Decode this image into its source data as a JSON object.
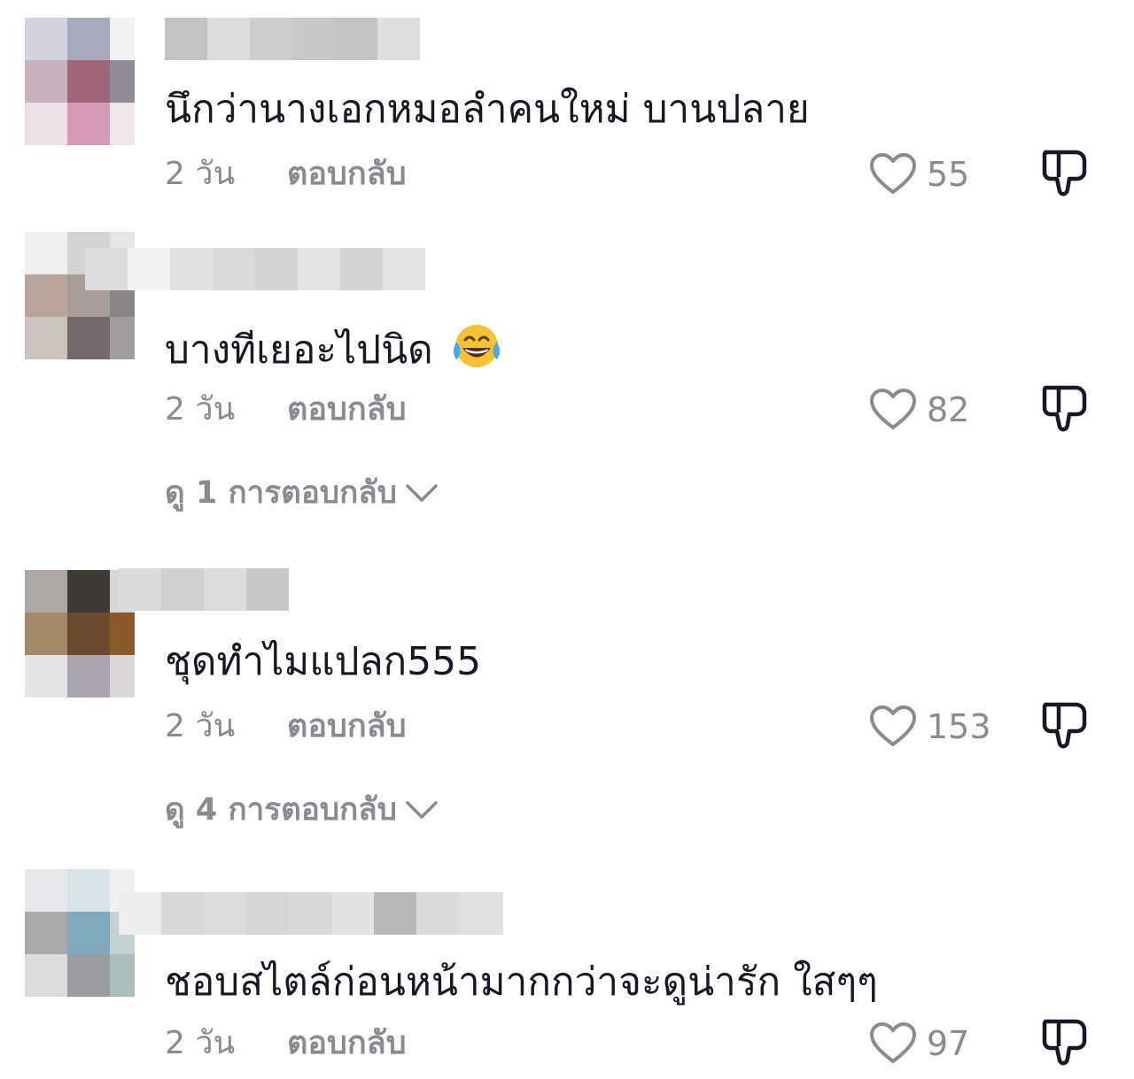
{
  "colors": {
    "text_primary": "#161823",
    "text_secondary": "#8a8b91",
    "background": "#ffffff"
  },
  "icons": {
    "like": "heart-outline-icon",
    "dislike": "thumbs-down-outline-icon",
    "expand": "chevron-down-icon",
    "emoji": "face-with-tears-of-joy-emoji"
  },
  "reply_label": "ตอบกลับ",
  "comments": [
    {
      "text": "นึกว่านางเอกหมอลำคนใหม่ บานปลาย",
      "time": "2 วัน",
      "likes": "55"
    },
    {
      "text": "บางทีเยอะไปนิด",
      "time": "2 วัน",
      "likes": "82",
      "view_replies": "ดู 1 การตอบกลับ"
    },
    {
      "text": "ชุดทำไมแปลก555",
      "time": "2 วัน",
      "likes": "153",
      "view_replies": "ดู 4 การตอบกลับ"
    },
    {
      "text": "ชอบสไตล์ก่อนหน้ามากกว่าจะดูน่ารัก ใสๆๆ",
      "time": "2 วัน",
      "likes": "97"
    }
  ]
}
